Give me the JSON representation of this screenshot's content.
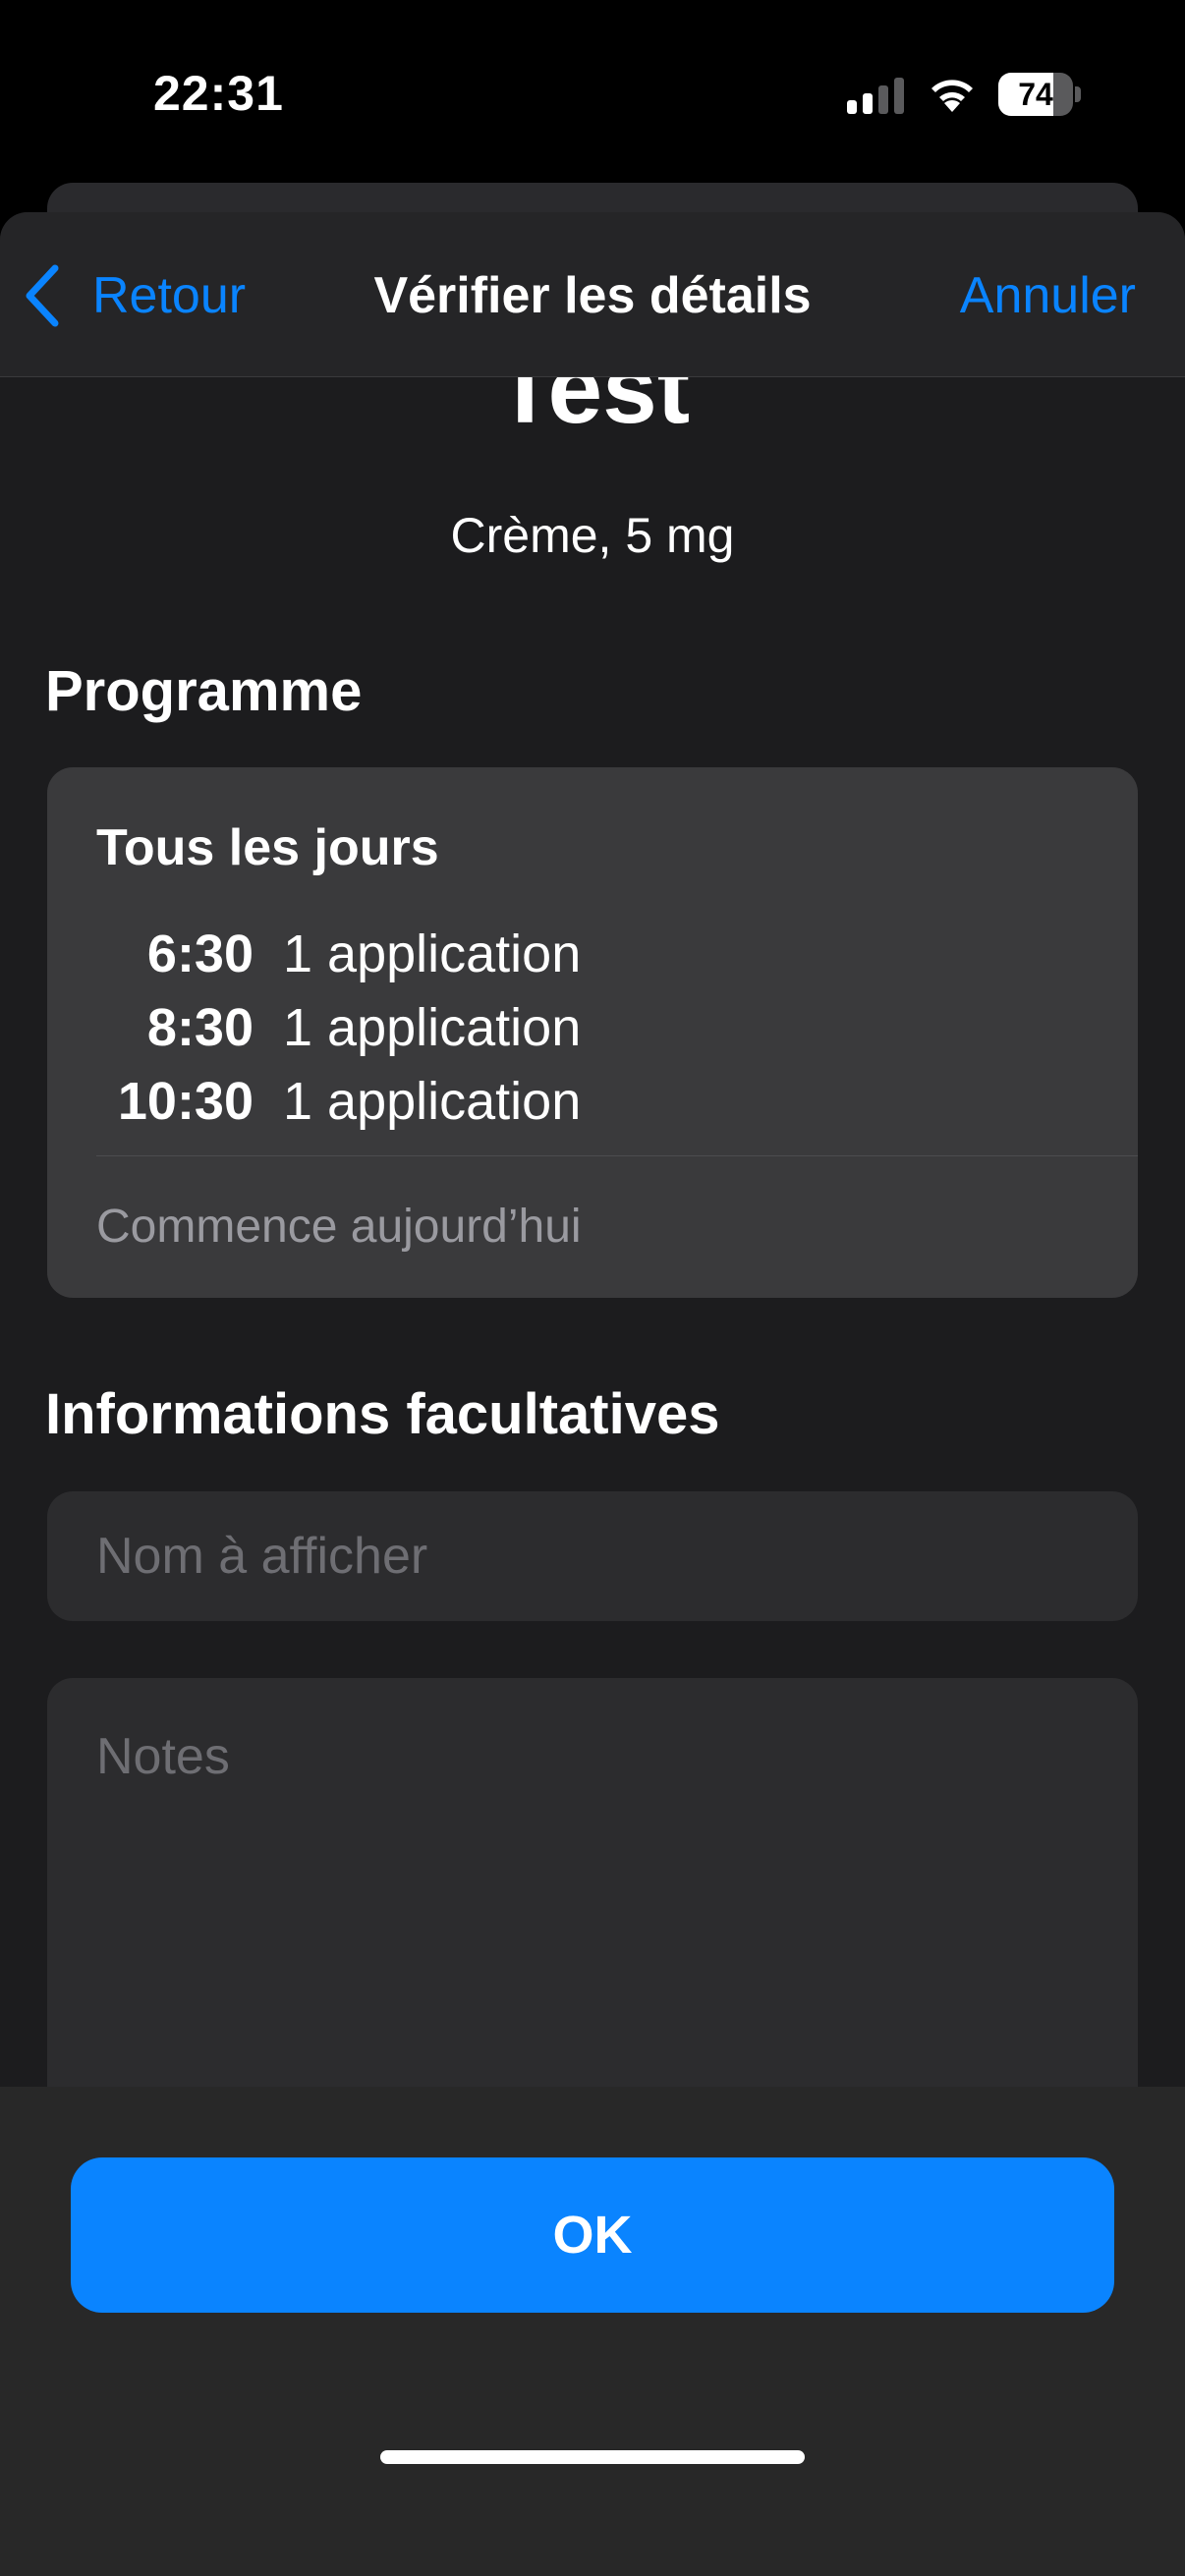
{
  "status_bar": {
    "time": "22:31",
    "battery_level": "74",
    "battery_fraction": 0.74
  },
  "nav": {
    "back_label": "Retour",
    "title": "Vérifier les détails",
    "cancel_label": "Annuler"
  },
  "medication": {
    "name": "Test",
    "detail": "Crème, 5 mg"
  },
  "schedule": {
    "section_title": "Programme",
    "frequency": "Tous les jours",
    "doses": [
      {
        "time": "6:30",
        "amount": "1 application"
      },
      {
        "time": "8:30",
        "amount": "1 application"
      },
      {
        "time": "10:30",
        "amount": "1 application"
      }
    ],
    "start": "Commence aujourd’hui"
  },
  "optional": {
    "section_title": "Informations facultatives",
    "display_name_placeholder": "Nom à afficher",
    "notes_placeholder": "Notes"
  },
  "footer": {
    "ok_label": "OK"
  },
  "colors": {
    "accent": "#0a84ff",
    "background": "#1c1c1e",
    "card": "#3a3a3c"
  }
}
